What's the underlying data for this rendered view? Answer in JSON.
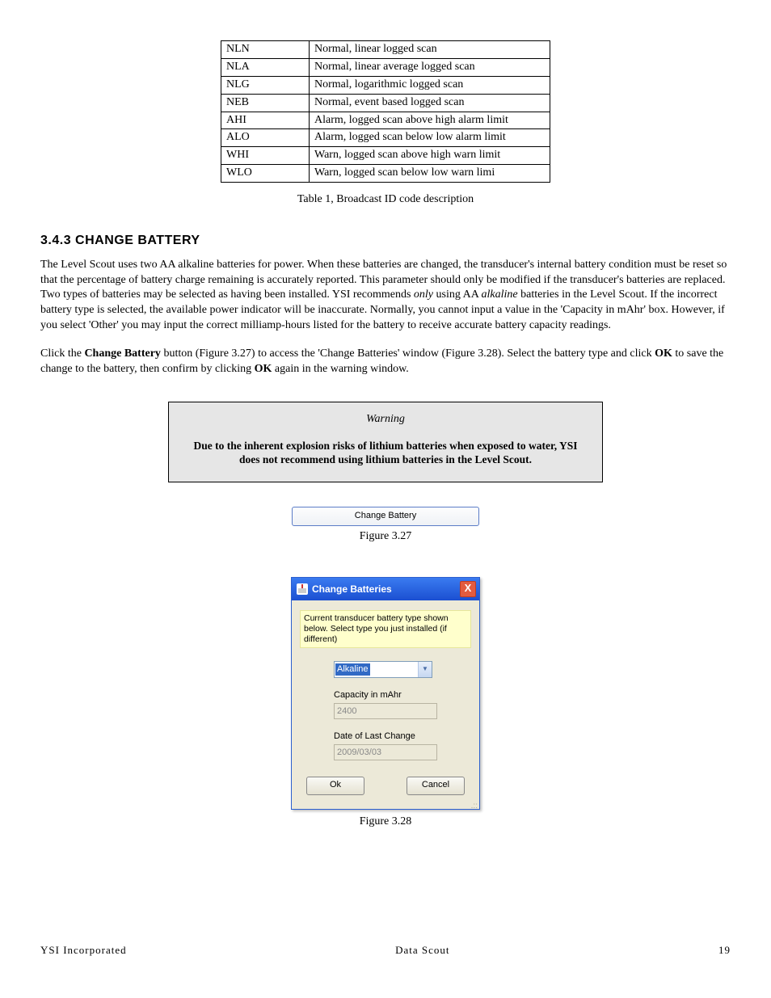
{
  "table": {
    "rows": [
      {
        "code": "NLN",
        "desc": "Normal, linear logged scan"
      },
      {
        "code": "NLA",
        "desc": "Normal, linear average logged scan"
      },
      {
        "code": "NLG",
        "desc": "Normal, logarithmic logged scan"
      },
      {
        "code": "NEB",
        "desc": "Normal, event based logged scan"
      },
      {
        "code": "AHI",
        "desc": "Alarm, logged scan above high alarm limit"
      },
      {
        "code": "ALO",
        "desc": "Alarm, logged scan below low alarm limit"
      },
      {
        "code": "WHI",
        "desc": "Warn, logged scan above high warn limit"
      },
      {
        "code": "WLO",
        "desc": "Warn, logged scan below low warn limi"
      }
    ],
    "caption": "Table 1, Broadcast ID code description"
  },
  "section": {
    "heading": "3.4.3 CHANGE BATTERY",
    "para1_a": "The Level Scout uses two AA alkaline batteries for power.  When these batteries are changed, the transducer's internal battery condition must be reset so that the percentage of battery charge remaining is accurately reported. This parameter should only be modified if the transducer's batteries are replaced. Two types of batteries may be selected as having been installed. YSI recommends ",
    "para1_only": "only",
    "para1_b": " using AA ",
    "para1_alk": "alkaline",
    "para1_c": " batteries in the Level Scout. If the incorrect battery type is selected, the available power indicator will be inaccurate. Normally, you cannot input a value in the 'Capacity in mAhr' box.  However, if you select 'Other' you may input the correct milliamp-hours listed for the battery to receive accurate battery capacity readings.",
    "para2_a": "Click the ",
    "para2_cb": "Change Battery",
    "para2_b": " button (Figure 3.27) to access the 'Change Batteries' window (Figure 3.28). Select the battery type and click ",
    "para2_ok1": "OK",
    "para2_c": " to save the change to the battery, then confirm by clicking ",
    "para2_ok2": "OK",
    "para2_d": " again in the warning window."
  },
  "warning": {
    "title": "Warning",
    "body": "Due to the inherent explosion risks of lithium batteries when exposed to water, YSI does not recommend using lithium batteries in the Level Scout."
  },
  "button": {
    "label": "Change Battery"
  },
  "fig327": "Figure 3.27",
  "dialog": {
    "title": "Change Batteries",
    "close": "X",
    "info": "Current transducer battery type shown below. Select type you just installed (if different)",
    "select_value": "Alkaline",
    "capacity_label": "Capacity in mAhr",
    "capacity_value": "2400",
    "date_label": "Date of Last Change",
    "date_value": "2009/03/03",
    "ok": "Ok",
    "cancel": "Cancel"
  },
  "fig328": "Figure 3.28",
  "footer": {
    "left": "YSI Incorporated",
    "center": "Data Scout",
    "right": "19"
  }
}
